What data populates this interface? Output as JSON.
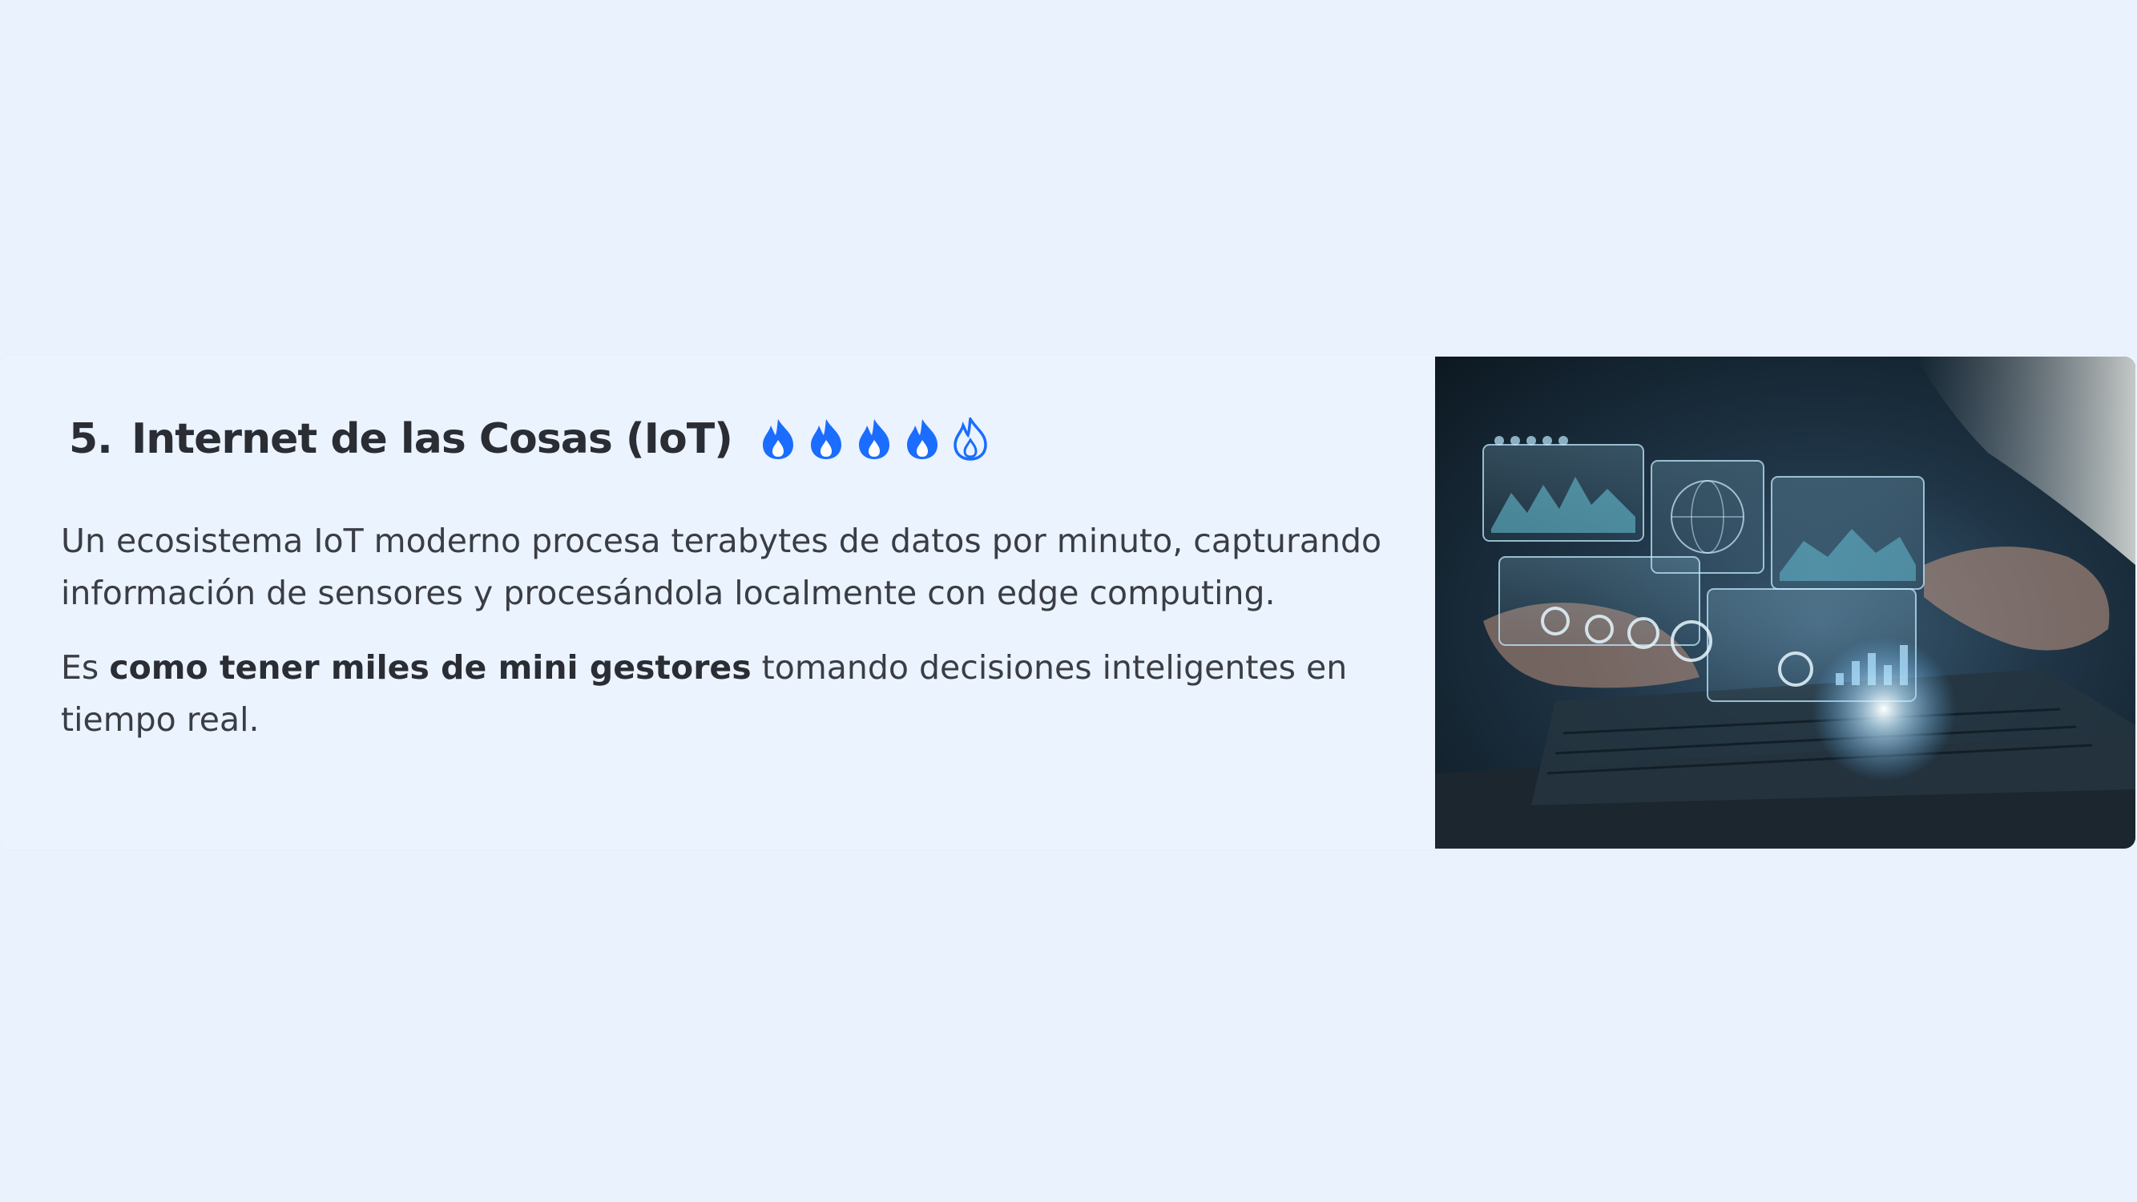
{
  "section": {
    "number": "5.",
    "title": "Internet de las Cosas (IoT)",
    "rating": {
      "value": 4,
      "max": 5,
      "icon": "flame-icon",
      "color": "#1a6dff"
    }
  },
  "content": {
    "paragraph1": "Un ecosistema IoT moderno procesa terabytes de datos por minuto, capturando información de sensores y procesándola localmente con edge computing.",
    "paragraph2": {
      "prefix": "Es ",
      "bold": "como tener miles de mini gestores",
      "suffix": " tomando decisiones inteligentes en tiempo real."
    }
  },
  "image": {
    "subject": "laptop-hud-dashboard-photo"
  }
}
